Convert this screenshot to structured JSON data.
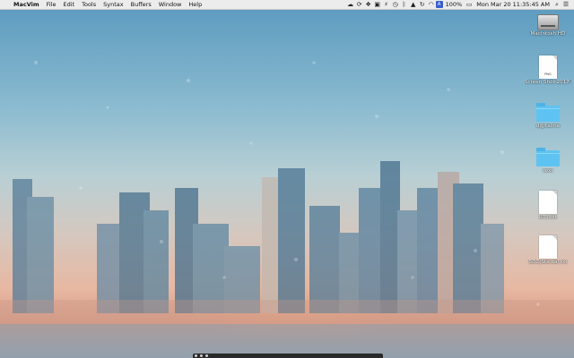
{
  "menubar": {
    "app_name": "MacVim",
    "menus": [
      "File",
      "Edit",
      "Tools",
      "Syntax",
      "Buffers",
      "Window",
      "Help"
    ],
    "battery_percent": "100%",
    "datetime": "Mon Mar 20  11:35:45 AM",
    "status_icons": [
      "creative-cloud-icon",
      "sync-icon",
      "dropbox-icon",
      "box-icon",
      "bolt-icon",
      "clock-icon",
      "bluetooth-icon",
      "vpn-icon",
      "refresh-icon",
      "wifi-icon",
      "input-source-icon",
      "battery-icon",
      "search-icon",
      "list-icon"
    ]
  },
  "desktop": {
    "items": [
      {
        "label": "Macintosh HD",
        "icon": "hard-drive-icon"
      },
      {
        "label": "Screen Shot 2017-03-20 at 11.3...",
        "icon": "screenshot-file-icon"
      },
      {
        "label": "digitalme",
        "icon": "folder-icon"
      },
      {
        "label": "text",
        "icon": "folder-icon"
      },
      {
        "label": "RTS.txt",
        "icon": "text-file-icon"
      },
      {
        "label": "SDC(Ste.bal.txt",
        "icon": "text-file-icon"
      }
    ]
  },
  "wallpaper": {
    "description_colors": [
      "#5e9cc0",
      "#d4c8c0",
      "#e7b8a2"
    ]
  }
}
